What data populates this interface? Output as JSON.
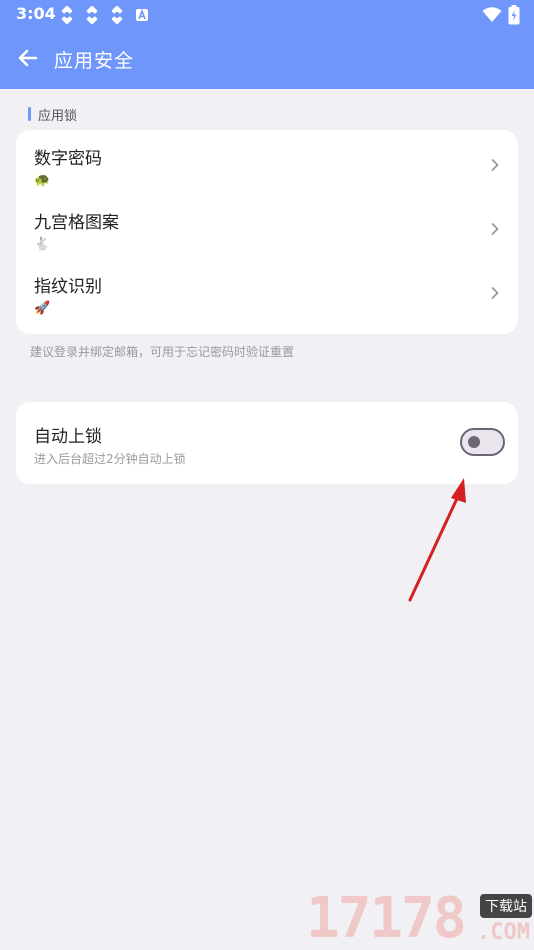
{
  "status_bar": {
    "time": "3:04",
    "left_icons": [
      "sync-icon",
      "sync-icon",
      "sync-icon",
      "font-a-icon"
    ],
    "right_icons": [
      "wifi-icon",
      "battery-charging-icon"
    ]
  },
  "header": {
    "title": "应用安全",
    "background": "#6f96fa"
  },
  "app_lock": {
    "section_label": "应用锁",
    "items": [
      {
        "label": "数字密码",
        "emoji": "🐢"
      },
      {
        "label": "九宫格图案",
        "emoji": "🐇"
      },
      {
        "label": "指纹识别",
        "emoji": "🚀"
      }
    ],
    "hint": "建议登录并绑定邮箱，可用于忘记密码时验证重置"
  },
  "auto_lock": {
    "title": "自动上锁",
    "subtitle": "进入后台超过2分钟自动上锁",
    "enabled": false
  },
  "watermark": {
    "number": "17178",
    "tag": "下载站",
    "suffix": ".COM"
  },
  "colors": {
    "accent": "#6f96fa",
    "annotation_arrow": "#d42020"
  }
}
